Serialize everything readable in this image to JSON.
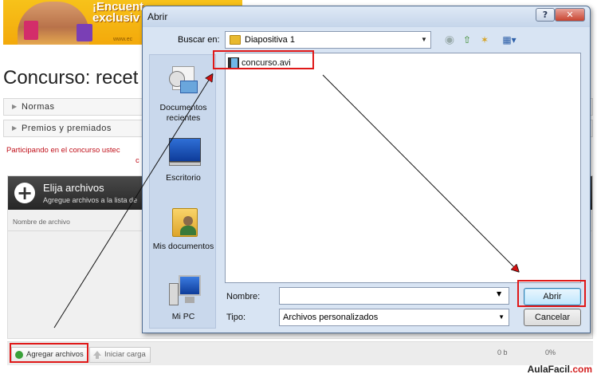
{
  "banner": {
    "headline_1": "¡Encuent",
    "headline_2": "exclusiv",
    "footer": "www.ec"
  },
  "page": {
    "title": "Concurso: recet"
  },
  "accordion": [
    {
      "label": "Normas"
    },
    {
      "label": "Premios y premiados"
    }
  ],
  "notice": {
    "line1": "Participando en el concurso ustec",
    "line2": "c"
  },
  "uploader": {
    "title": "Elija archivos",
    "subtitle": "Agregue archivos a la lista de",
    "column_name": "Nombre de archivo",
    "add_button": "Agregar archivos",
    "start_button": "Iniciar carga",
    "size": "0 b",
    "percent": "0%"
  },
  "dialog": {
    "title": "Abrir",
    "help_symbol": "?",
    "close_symbol": "✕",
    "lookin_label": "Buscar en:",
    "lookin_value": "Diapositiva 1",
    "places": [
      {
        "label": "Documentos recientes",
        "icon": "recent-documents-icon"
      },
      {
        "label": "Escritorio",
        "icon": "desktop-icon"
      },
      {
        "label": "Mis documentos",
        "icon": "my-documents-icon"
      },
      {
        "label": "Mi PC",
        "icon": "my-computer-icon"
      }
    ],
    "files": [
      {
        "name": "concurso.avi",
        "icon": "video-file-icon"
      }
    ],
    "filename_label": "Nombre:",
    "filename_value": "",
    "filetype_label": "Tipo:",
    "filetype_value": "Archivos personalizados",
    "open_button": "Abrir",
    "cancel_button": "Cancelar"
  },
  "brand": {
    "prefix": "AulaFacil",
    "suffix": ".com"
  },
  "colors": {
    "highlight": "#e01818",
    "arrow": "#111111",
    "dialog_bg": "#d8e4f3"
  }
}
